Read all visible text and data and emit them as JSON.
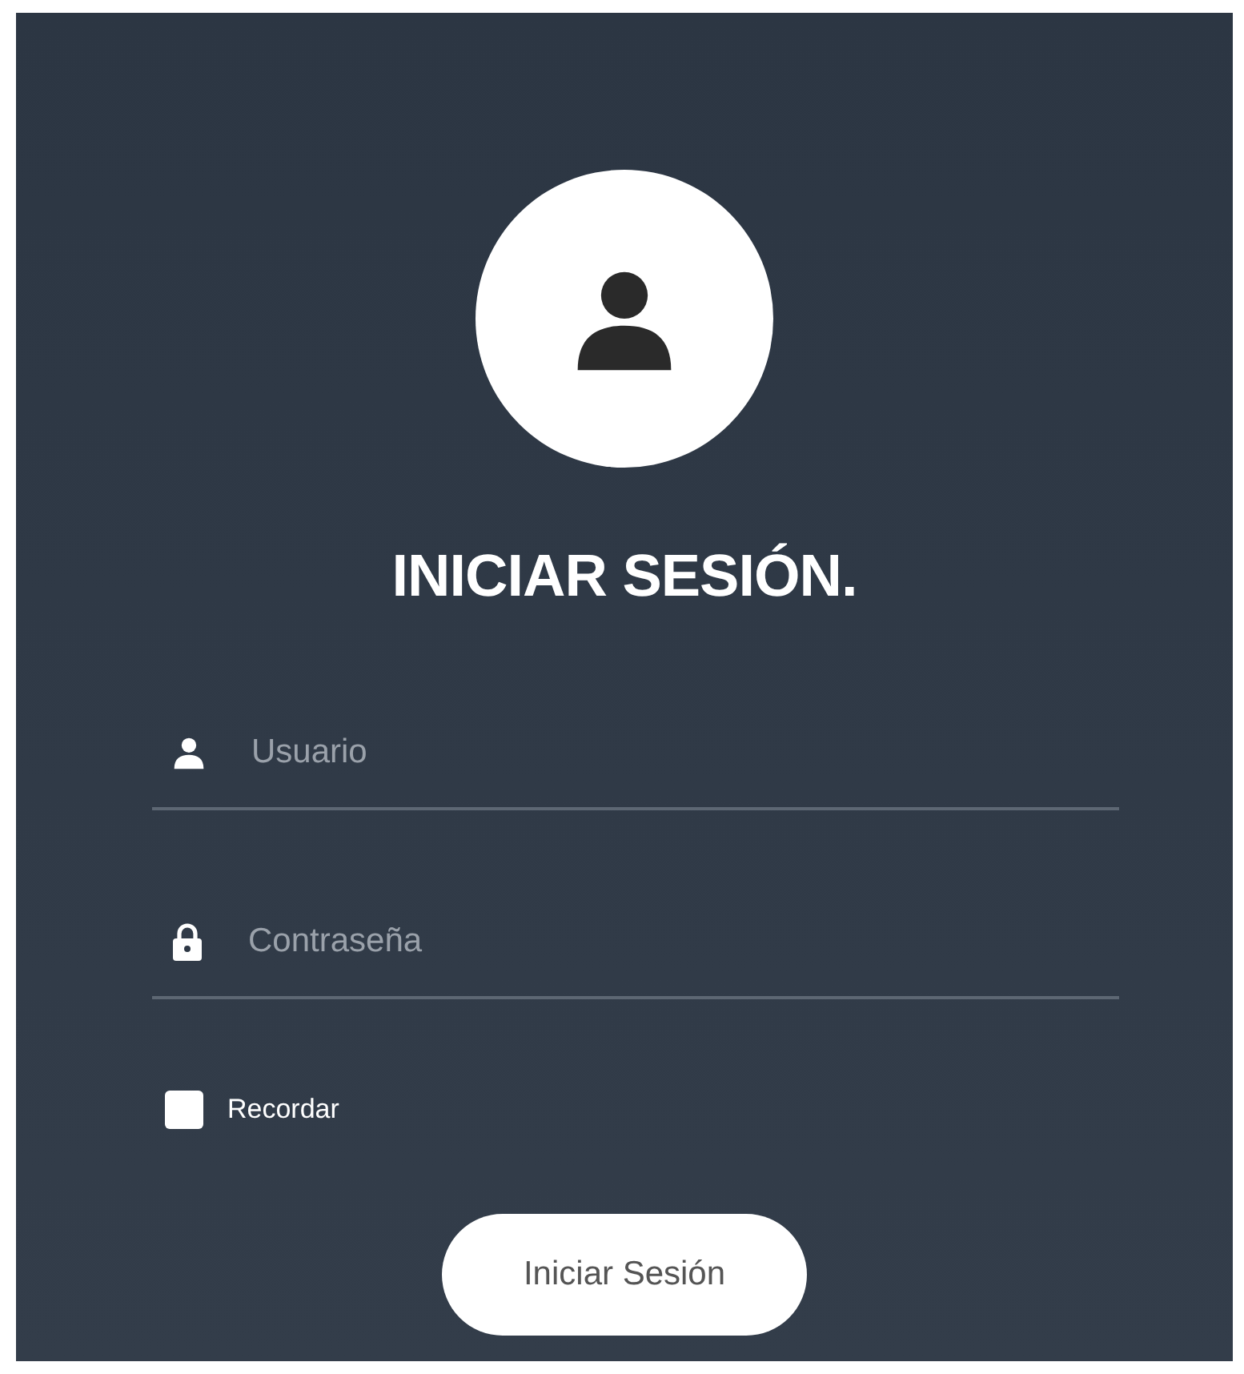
{
  "title": "INICIAR SESIÓN.",
  "fields": [
    {
      "kind": "user",
      "placeholder": "Usuario"
    },
    {
      "kind": "password",
      "placeholder": "Contraseña"
    }
  ],
  "remember": {
    "label": "Recordar",
    "checked": false
  },
  "button": "Iniciar Sesión"
}
